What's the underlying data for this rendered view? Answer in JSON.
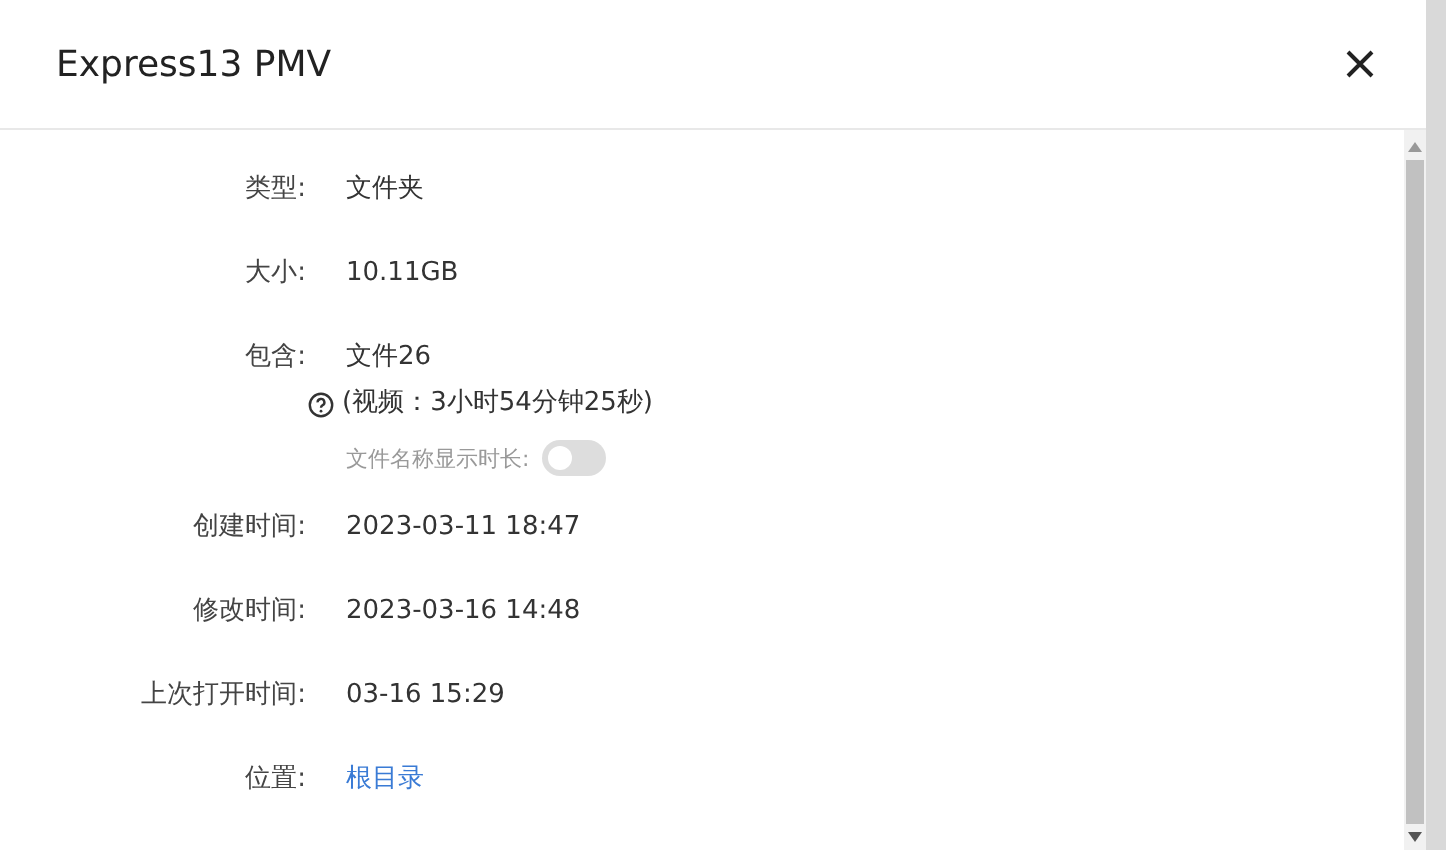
{
  "dialog": {
    "title": "Express13 PMV"
  },
  "rows": [
    {
      "kind": "text",
      "label": "类型:",
      "value": "文件夹"
    },
    {
      "kind": "text",
      "label": "大小:",
      "value": "10.11GB"
    },
    {
      "kind": "contains",
      "label": "包含:",
      "value": "文件26",
      "detail": "(视频：3小时54分钟25秒)",
      "toggle": {
        "label": "文件名称显示时长:",
        "on": false
      }
    },
    {
      "kind": "text",
      "label": "创建时间:",
      "value": "2023-03-11 18:47"
    },
    {
      "kind": "text",
      "label": "修改时间:",
      "value": "2023-03-16 14:48"
    },
    {
      "kind": "text",
      "label": "上次打开时间:",
      "value": "03-16 15:29"
    },
    {
      "kind": "link",
      "label": "位置:",
      "value": "根目录"
    }
  ]
}
